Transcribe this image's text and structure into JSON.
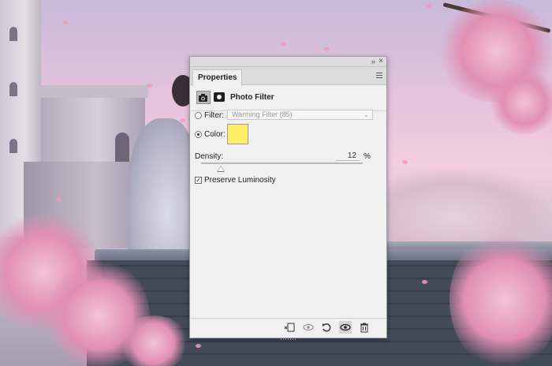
{
  "panel": {
    "tab_label": "Properties",
    "adjustment_title": "Photo Filter",
    "filter_label": "Filter:",
    "filter_value": "Warming Filter (85)",
    "color_label": "Color:",
    "color_value": "#ffee66",
    "density_label": "Density:",
    "density_value": "12",
    "density_fraction": 0.12,
    "density_unit": "%",
    "preserve_luminosity_label": "Preserve Luminosity",
    "preserve_luminosity_checked": true,
    "selected_option": "color"
  },
  "footer_icons": [
    "clip-to-layer-icon",
    "view-previous-state-icon",
    "reset-icon",
    "visibility-icon",
    "trash-icon"
  ],
  "icons": {
    "collapse": "»",
    "close": "×",
    "chevron": "⌄",
    "check": "✓"
  }
}
